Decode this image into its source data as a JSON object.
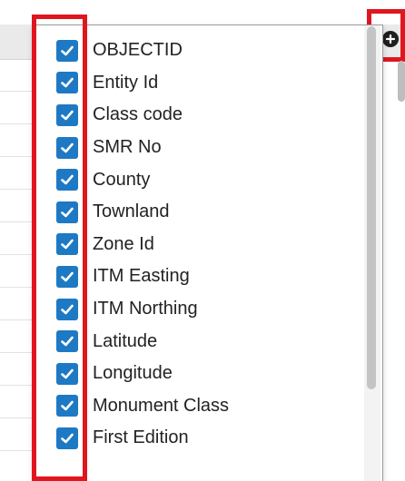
{
  "fields": [
    {
      "label": "OBJECTID",
      "checked": true
    },
    {
      "label": "Entity Id",
      "checked": true
    },
    {
      "label": "Class code",
      "checked": true
    },
    {
      "label": "SMR No",
      "checked": true
    },
    {
      "label": "County",
      "checked": true
    },
    {
      "label": "Townland",
      "checked": true
    },
    {
      "label": "Zone Id",
      "checked": true
    },
    {
      "label": "ITM Easting",
      "checked": true
    },
    {
      "label": "ITM Northing",
      "checked": true
    },
    {
      "label": "Latitude",
      "checked": true
    },
    {
      "label": "Longitude",
      "checked": true
    },
    {
      "label": "Monument Class",
      "checked": true
    },
    {
      "label": "First Edition",
      "checked": true
    }
  ],
  "colors": {
    "checkbox_blue": "#1e79c4",
    "highlight_red": "#e0161e"
  },
  "icons": {
    "checkmark": "check-icon",
    "add": "plus-circle-icon"
  }
}
